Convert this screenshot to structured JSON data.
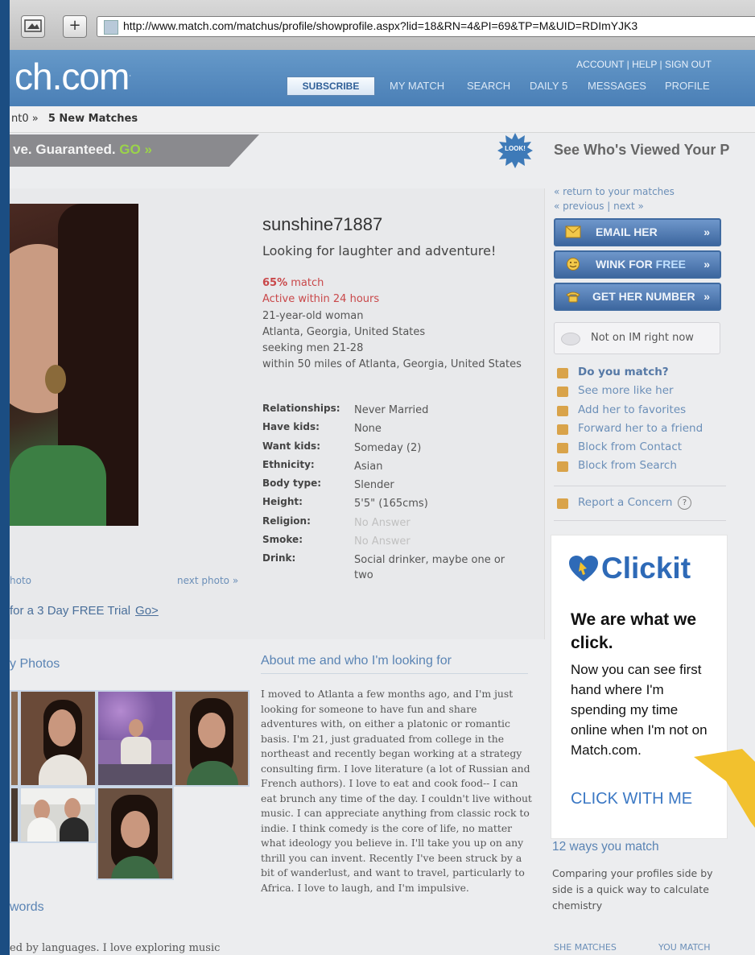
{
  "browser": {
    "url": "http://www.match.com/matchus/profile/showprofile.aspx?lid=18&RN=4&PI=69&TP=M&UID=RDImYJK3"
  },
  "header": {
    "logo": "ch.com",
    "top_links": "ACCOUNT | HELP | SIGN OUT",
    "subscribe": "SUBSCRIBE",
    "nav": [
      "MY MATCH",
      "SEARCH",
      "DAILY 5",
      "MESSAGES",
      "PROFILE"
    ]
  },
  "subnav": {
    "crumb_prefix": "nt0 »",
    "crumb_bold": "5 New Matches"
  },
  "promo": {
    "text": "ve. Guaranteed.",
    "go": "GO »",
    "badge": "LOOK!",
    "viewed": "See Who's Viewed Your P"
  },
  "profile": {
    "username": "sunshine71887",
    "headline": "Looking for laughter and adventure!",
    "match_pct": "65%",
    "match_word": "match",
    "active": "Active within 24 hours",
    "basics": [
      "21-year-old woman",
      "Atlanta, Georgia, United States",
      "seeking men 21-28",
      "within 50 miles of Atlanta, Georgia, United States"
    ],
    "details": [
      {
        "label": "Relationships:",
        "value": "Never Married"
      },
      {
        "label": "Have kids:",
        "value": "None"
      },
      {
        "label": "Want kids:",
        "value": "Someday (2)"
      },
      {
        "label": "Ethnicity:",
        "value": "Asian"
      },
      {
        "label": "Body type:",
        "value": "Slender"
      },
      {
        "label": "Height:",
        "value": "5'5\" (165cms)"
      },
      {
        "label": "Religion:",
        "value": "No Answer"
      },
      {
        "label": "Smoke:",
        "value": "No Answer"
      },
      {
        "label": "Drink:",
        "value": "Social drinker, maybe one or two"
      }
    ],
    "prev_photo": "hoto",
    "next_photo": "next photo »",
    "trial": "for a 3 Day FREE Trial",
    "trial_go": "Go>"
  },
  "photos": {
    "title": "y Photos"
  },
  "keywords": {
    "title": "words",
    "text": "ed by languages. I love exploring music"
  },
  "about": {
    "title": "About me and who I'm looking for",
    "body": "I moved to Atlanta a few months ago, and I'm just looking for someone to have fun and share adventures with, on either a platonic or romantic basis. I'm 21, just graduated from college in the northeast and recently began working at a strategy consulting firm. I love literature (a lot of Russian and French authors). I love to eat and cook food-- I can eat brunch any time of the day. I couldn't live without music. I can appreciate anything from classic rock to indie. I think comedy is the core of life, no matter what ideology you believe in. I'll take you up on any thrill you can invent. Recently I've been struck by a bit of wanderlust, and want to travel, particularly to Africa. I love to laugh, and I'm impulsive."
  },
  "sidebar": {
    "return": "« return to your matches",
    "previous": "« previous",
    "next": "next »",
    "email": {
      "label": "EMAIL HER",
      "arrow": "»"
    },
    "wink": {
      "label": "WINK FOR",
      "free": "FREE",
      "arrow": "»"
    },
    "number": {
      "label": "GET HER NUMBER",
      "arrow": "»"
    },
    "im_status": "Not on IM right now",
    "actions": [
      "Do you match?",
      "See more like her",
      "Add her to favorites",
      "Forward her to a friend",
      "Block from Contact",
      "Block from Search"
    ],
    "report": "Report a Concern",
    "help_icon_glyph": "?"
  },
  "ad": {
    "brand": "Clickit",
    "headline": "We are what we click.",
    "body": "Now you can see first hand where I'm spending my time online when I'm not on Match.com.",
    "cta": "CLICK WITH ME"
  },
  "ways": {
    "title": "12 ways you match",
    "body": "Comparing your profiles side by side is a quick way to calculate chemistry",
    "she": "SHE MATCHES",
    "you": "YOU MATCH"
  },
  "colors": {
    "brand_blue": "#4a7fb6",
    "match_red": "#c9484a",
    "link_blue": "#6b8fb8",
    "ad_yellow": "#f2c12e"
  }
}
